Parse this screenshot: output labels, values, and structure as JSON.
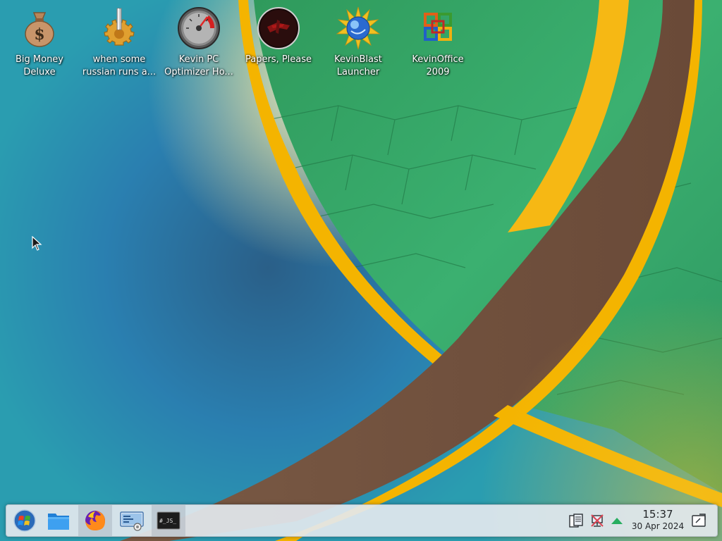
{
  "desktop": {
    "icons": [
      {
        "label_line1": "Big Money",
        "label_line2": "Deluxe",
        "icon": "money-bag-icon"
      },
      {
        "label_line1": "when some",
        "label_line2": "russian runs a...",
        "icon": "gear-icon"
      },
      {
        "label_line1": "Kevin PC",
        "label_line2": "Optimizer Ho...",
        "icon": "speedometer-icon"
      },
      {
        "label_line1": "Papers, Please",
        "label_line2": "",
        "icon": "papers-please-icon"
      },
      {
        "label_line1": "KevinBlast",
        "label_line2": "Launcher",
        "icon": "blast-launcher-icon"
      },
      {
        "label_line1": "KevinOffice",
        "label_line2": "2009",
        "icon": "office-icon"
      }
    ]
  },
  "taskbar": {
    "launchers": [
      {
        "icon": "start-menu-icon"
      },
      {
        "icon": "file-manager-icon"
      },
      {
        "icon": "firefox-icon"
      },
      {
        "icon": "system-settings-icon"
      },
      {
        "icon": "terminal-icon"
      }
    ],
    "tray": [
      {
        "icon": "clipboard-icon"
      },
      {
        "icon": "network-disconnected-icon"
      },
      {
        "icon": "show-hidden-icons-icon"
      }
    ],
    "clock": {
      "time": "15:37",
      "date": "30 Apr 2024"
    },
    "show_desktop_icon": "show-desktop-icon",
    "terminal_glyph": "#_JS_"
  }
}
